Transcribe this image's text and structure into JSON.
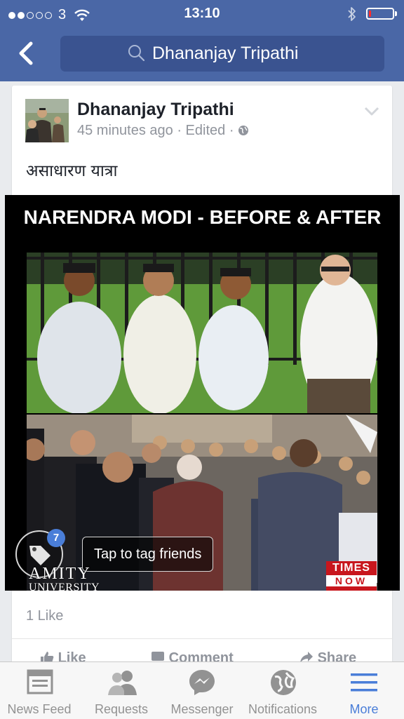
{
  "status_bar": {
    "carrier": "3",
    "time": "13:10",
    "signal_bars": 2,
    "signal_max": 5,
    "battery_level": 0.08,
    "battery_color": "#ff2a2a"
  },
  "nav": {
    "back_icon": "chevron-left-icon",
    "search_icon": "search-icon",
    "search_text": "Dhananjay Tripathi"
  },
  "post": {
    "author": "Dhananjay Tripathi",
    "time": "45 minutes ago",
    "edited": "Edited",
    "privacy_icon": "globe-icon",
    "menu_icon": "chevron-down-icon",
    "text": "असाधारण यात्रा",
    "photo": {
      "title": "NARENDRA MODI - BEFORE & AFTER",
      "tag_count": "7",
      "tag_prompt": "Tap to tag friends",
      "watermark_line1": "AMITY",
      "watermark_line2": "UNIVERSITY",
      "logo_times": "TIMES",
      "logo_now": "NOW"
    },
    "likes": "1 Like",
    "actions": [
      "Like",
      "Comment",
      "Share"
    ]
  },
  "tab_bar": {
    "active": "More",
    "accent": "#4a7ed8",
    "items": [
      {
        "label": "News Feed",
        "icon": "news-feed-icon"
      },
      {
        "label": "Requests",
        "icon": "friend-requests-icon"
      },
      {
        "label": "Messenger",
        "icon": "messenger-icon"
      },
      {
        "label": "Notifications",
        "icon": "globe-icon"
      },
      {
        "label": "More",
        "icon": "hamburger-menu-icon"
      }
    ]
  },
  "colors": {
    "brand_blue": "#4a67a6",
    "search_field": "#3a5390",
    "background": "#e9ebee"
  }
}
